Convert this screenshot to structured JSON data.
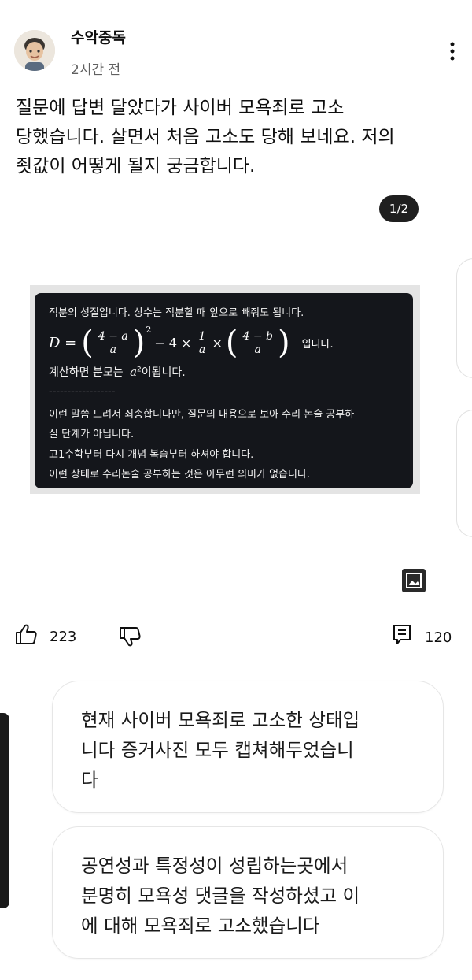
{
  "post": {
    "author": "수악중독",
    "time": "2시간 전",
    "body": "질문에 답변 달았다가 사이버 모욕죄로 고소\n당했습니다. 살면서 처음 고소도 당해 보네요. 저의\n죗값이 어떻게 될지 궁금합니다.",
    "image_counter": "1/2"
  },
  "image": {
    "line1": "적분의 성질입니다. 상수는 적분할 때 앞으로 빼줘도 됩니다.",
    "formula": {
      "lhs": "D =",
      "frac1_num": "4 − a",
      "frac1_den": "a",
      "exp": "2",
      "mid": "− 4 ×",
      "frac2_num": "1",
      "frac2_den": "a",
      "times": "×",
      "frac3_num": "4 − b",
      "frac3_den": "a",
      "suffix": "입니다."
    },
    "line3_prefix": "계산하면 분모는",
    "line3_math": "a",
    "line3_exp": "2",
    "line3_suffix": "이됩니다.",
    "divider": "------------------",
    "line5": "이런 말씀 드려서 죄송합니다만, 질문의 내용으로 보아 수리 논술 공부하",
    "line6": "실 단계가 아닙니다.",
    "line7": "고1수학부터 다시 개념 복습부터 하셔야 합니다.",
    "line8": "이런 상태로 수리논술 공부하는 것은 아무런 의미가 없습니다."
  },
  "actions": {
    "likes": "223",
    "comments": "120"
  },
  "comments": [
    {
      "text": "현재 사이버 모욕죄로 고소한 상태입\n니다 증거사진 모두 캡쳐해두었습니\n다"
    },
    {
      "text": "공연성과 특정성이 성립하는곳에서\n분명히 모욕성 댓글을 작성하셨고 이\n에 대해 모욕죄로 고소했습니다"
    }
  ],
  "icons": {
    "more": "more-vert-icon",
    "like": "thumb-up-icon",
    "dislike": "thumb-down-icon",
    "comment": "comment-icon",
    "gallery": "image-icon"
  }
}
